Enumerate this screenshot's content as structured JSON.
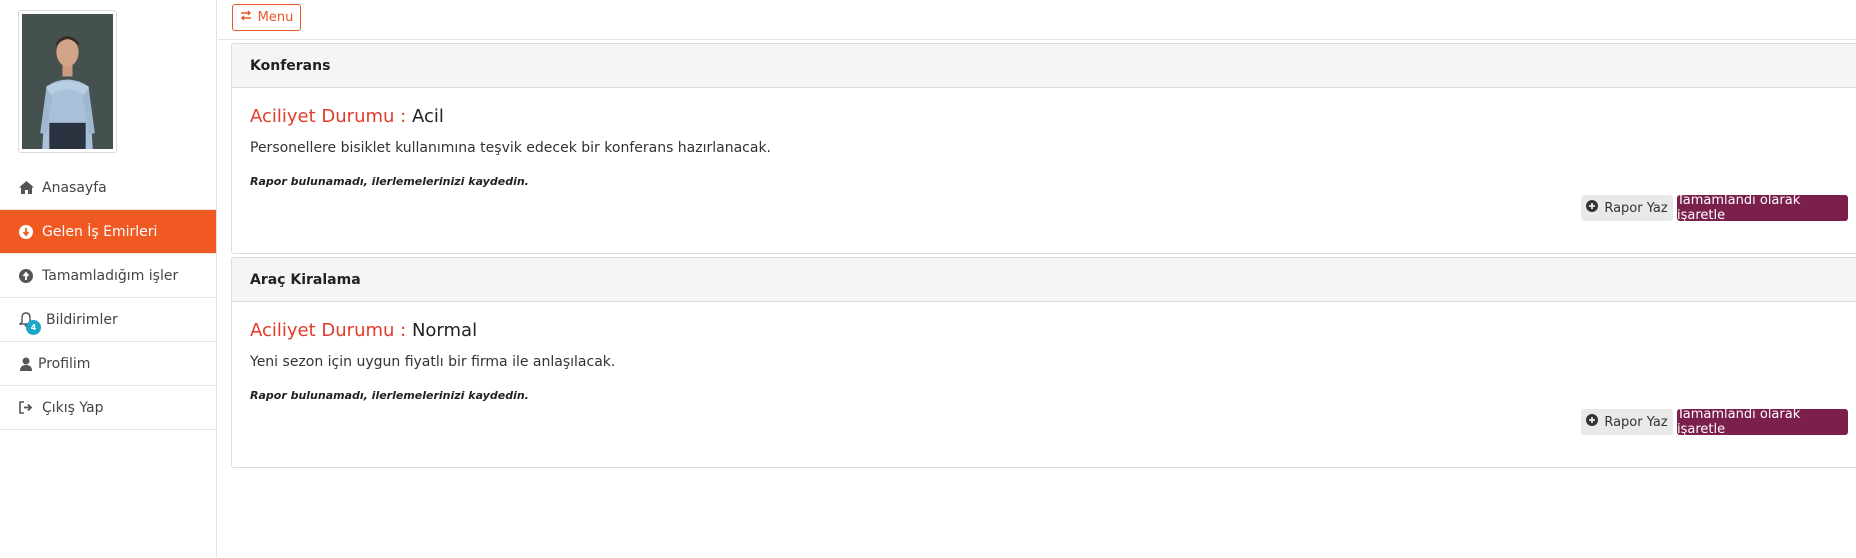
{
  "sidebar": {
    "items": [
      {
        "label": "Anasayfa",
        "icon": "home-icon"
      },
      {
        "label": "Gelen İş Emirleri",
        "icon": "arrow-circle-down-icon"
      },
      {
        "label": "Tamamladığım işler",
        "icon": "arrow-circle-up-icon"
      },
      {
        "label": "Bildirimler",
        "icon": "bell-icon",
        "badge": "4"
      },
      {
        "label": "Profilim",
        "icon": "user-icon"
      },
      {
        "label": "Çıkış Yap",
        "icon": "sign-out-icon"
      }
    ],
    "active_color": "#f05a22",
    "badge_color": "#1aa6c8"
  },
  "topbar": {
    "menu_label": "Menu",
    "menu_icon": "exchange-icon"
  },
  "cards": [
    {
      "title": "Konferans",
      "urgency_label": "Aciliyet Durumu :",
      "urgency_value": "Acil",
      "description": "Personellere bisiklet kullanımına teşvik edecek bir konferans hazırlanacak.",
      "note": "Rapor bulunamadı, ilerlemelerinizi kaydedin.",
      "report_button": "Rapor Yaz",
      "complete_button": "Tamamlandı olarak işaretle"
    },
    {
      "title": "Araç Kiralama",
      "urgency_label": "Aciliyet Durumu :",
      "urgency_value": "Normal",
      "description": "Yeni sezon için uygun fiyatlı bir firma ile anlaşılacak.",
      "note": "Rapor bulunamadı, ilerlemelerinizi kaydedin.",
      "report_button": "Rapor Yaz",
      "complete_button": "Tamamlandı olarak işaretle"
    }
  ],
  "colors": {
    "accent": "#f05a22",
    "urgency_label": "#e23b2a",
    "complete_button": "#7b1f4d"
  }
}
